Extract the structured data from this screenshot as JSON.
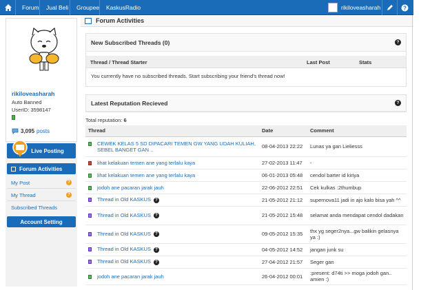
{
  "topbar": {
    "home_icon": "home-icon",
    "nav": [
      "Forum",
      "Jual Beli",
      "Groupee",
      "KaskusRadio"
    ],
    "username": "rikiloveasharah",
    "edit_icon": "pencil-icon",
    "help_icon": "question-icon"
  },
  "sidebar": {
    "username": "rikiloveasharah",
    "status": "Auto Banned",
    "user_id": "UserID: 3598147",
    "post_count": "3,095",
    "posts_label": "posts",
    "live_posting": "Live Posting",
    "forum_activities": "Forum Activities",
    "menu": [
      {
        "label": "My Post",
        "badge": "?"
      },
      {
        "label": "My Thread",
        "badge": "?"
      },
      {
        "label": "Subscribed Threads"
      }
    ],
    "account_setting": "Account Setting"
  },
  "main": {
    "title": "Forum Activities",
    "subscribed": {
      "title": "New Subscribed Threads (0)",
      "columns": [
        "Thread / Thread Starter",
        "Last Post",
        "Stats"
      ],
      "empty_message": "You currently have no subscribed threads. Start subscribing your friend's thread now!"
    },
    "reputation": {
      "title": "Latest Reputation Recieved",
      "total_label": "Total reputation:",
      "total_value": "6",
      "columns": [
        "Thread",
        "Date",
        "Comment"
      ],
      "rows": [
        {
          "status": "green",
          "thread": "CEWEK KELAS 5 SD DIPACARI TEMEN GW YANG UDAH KULIAH, SEBEL BANGET GAN ..",
          "date": "08-04-2013 22:22",
          "comment": "Lunas ya gan Lieliesss",
          "help": false
        },
        {
          "status": "red",
          "thread": "lihat kelakuan temen ane yang terlalu kaya",
          "date": "27-02-2013 11:47",
          "comment": "-",
          "help": false
        },
        {
          "status": "green",
          "thread": "lihat kelakuan temen ane yang terlalu kaya",
          "date": "06-01-2013 05:48",
          "comment": "cendol barter id kiriya",
          "help": false
        },
        {
          "status": "green",
          "thread": "jodoh ane pacaran jarak jauh",
          "date": "22-06-2012 22:51",
          "comment": "Cek kulkas :2thumbup",
          "help": false
        },
        {
          "status": "purple",
          "thread": "Thread in Old KASKUS",
          "date": "21-05-2012 21:12",
          "comment": "supernova11 jadi in ajo kalo bisa yah ^^",
          "help": true
        },
        {
          "status": "purple",
          "thread": "Thread in Old KASKUS",
          "date": "21-05-2012 15:48",
          "comment": "selamat anda mendapat cendol dadakan",
          "help": true
        },
        {
          "status": "purple",
          "thread": "Thread in Old KASKUS",
          "date": "09-05-2012 15:35",
          "comment": "thx yg seger2nya...gw balikin gelasnya ya :)",
          "help": true
        },
        {
          "status": "purple",
          "thread": "Thread in Old KASKUS",
          "date": "04-05-2012 14:52",
          "comment": "jangan junk su",
          "help": true
        },
        {
          "status": "purple",
          "thread": "Thread in Old KASKUS",
          "date": "27-04-2012 21:57",
          "comment": "Seger gan",
          "help": true
        },
        {
          "status": "green",
          "thread": "jodoh ane pacaran jarak jauh",
          "date": "26-04-2012 00:01",
          "comment": ":present: d74ti >> moga jodoh gan.. amien :)",
          "help": false
        }
      ]
    }
  }
}
